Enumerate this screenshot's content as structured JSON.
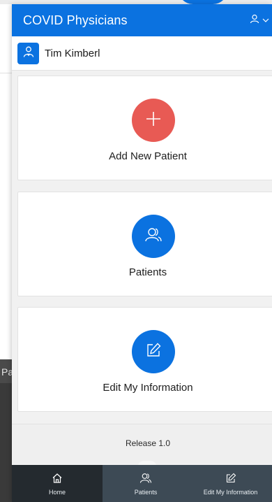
{
  "background": {
    "clipped_text": "Pa"
  },
  "header": {
    "title": "COVID Physicians",
    "user_icon": "user-icon",
    "menu_icon": "chevron-down-icon"
  },
  "user": {
    "name": "Tim Kimberl",
    "avatar_icon": "doctor-icon"
  },
  "cards": [
    {
      "label": "Add New Patient",
      "icon": "plus-icon",
      "color": "#e85a54"
    },
    {
      "label": "Patients",
      "icon": "users-icon",
      "color": "#0b72e0"
    },
    {
      "label": "Edit My Information",
      "icon": "edit-icon",
      "color": "#0b72e0"
    }
  ],
  "footer": {
    "release": "Release 1.0"
  },
  "tabs": [
    {
      "label": "Home",
      "icon": "home-icon",
      "active": true
    },
    {
      "label": "Patients",
      "icon": "users-icon",
      "active": false
    },
    {
      "label": "Edit My Information",
      "icon": "edit-icon",
      "active": false
    }
  ],
  "colors": {
    "primary": "#0b72e0",
    "accent_red": "#e85a54",
    "tabbar": "#3d4a55",
    "tabbar_active": "#242a2f"
  }
}
